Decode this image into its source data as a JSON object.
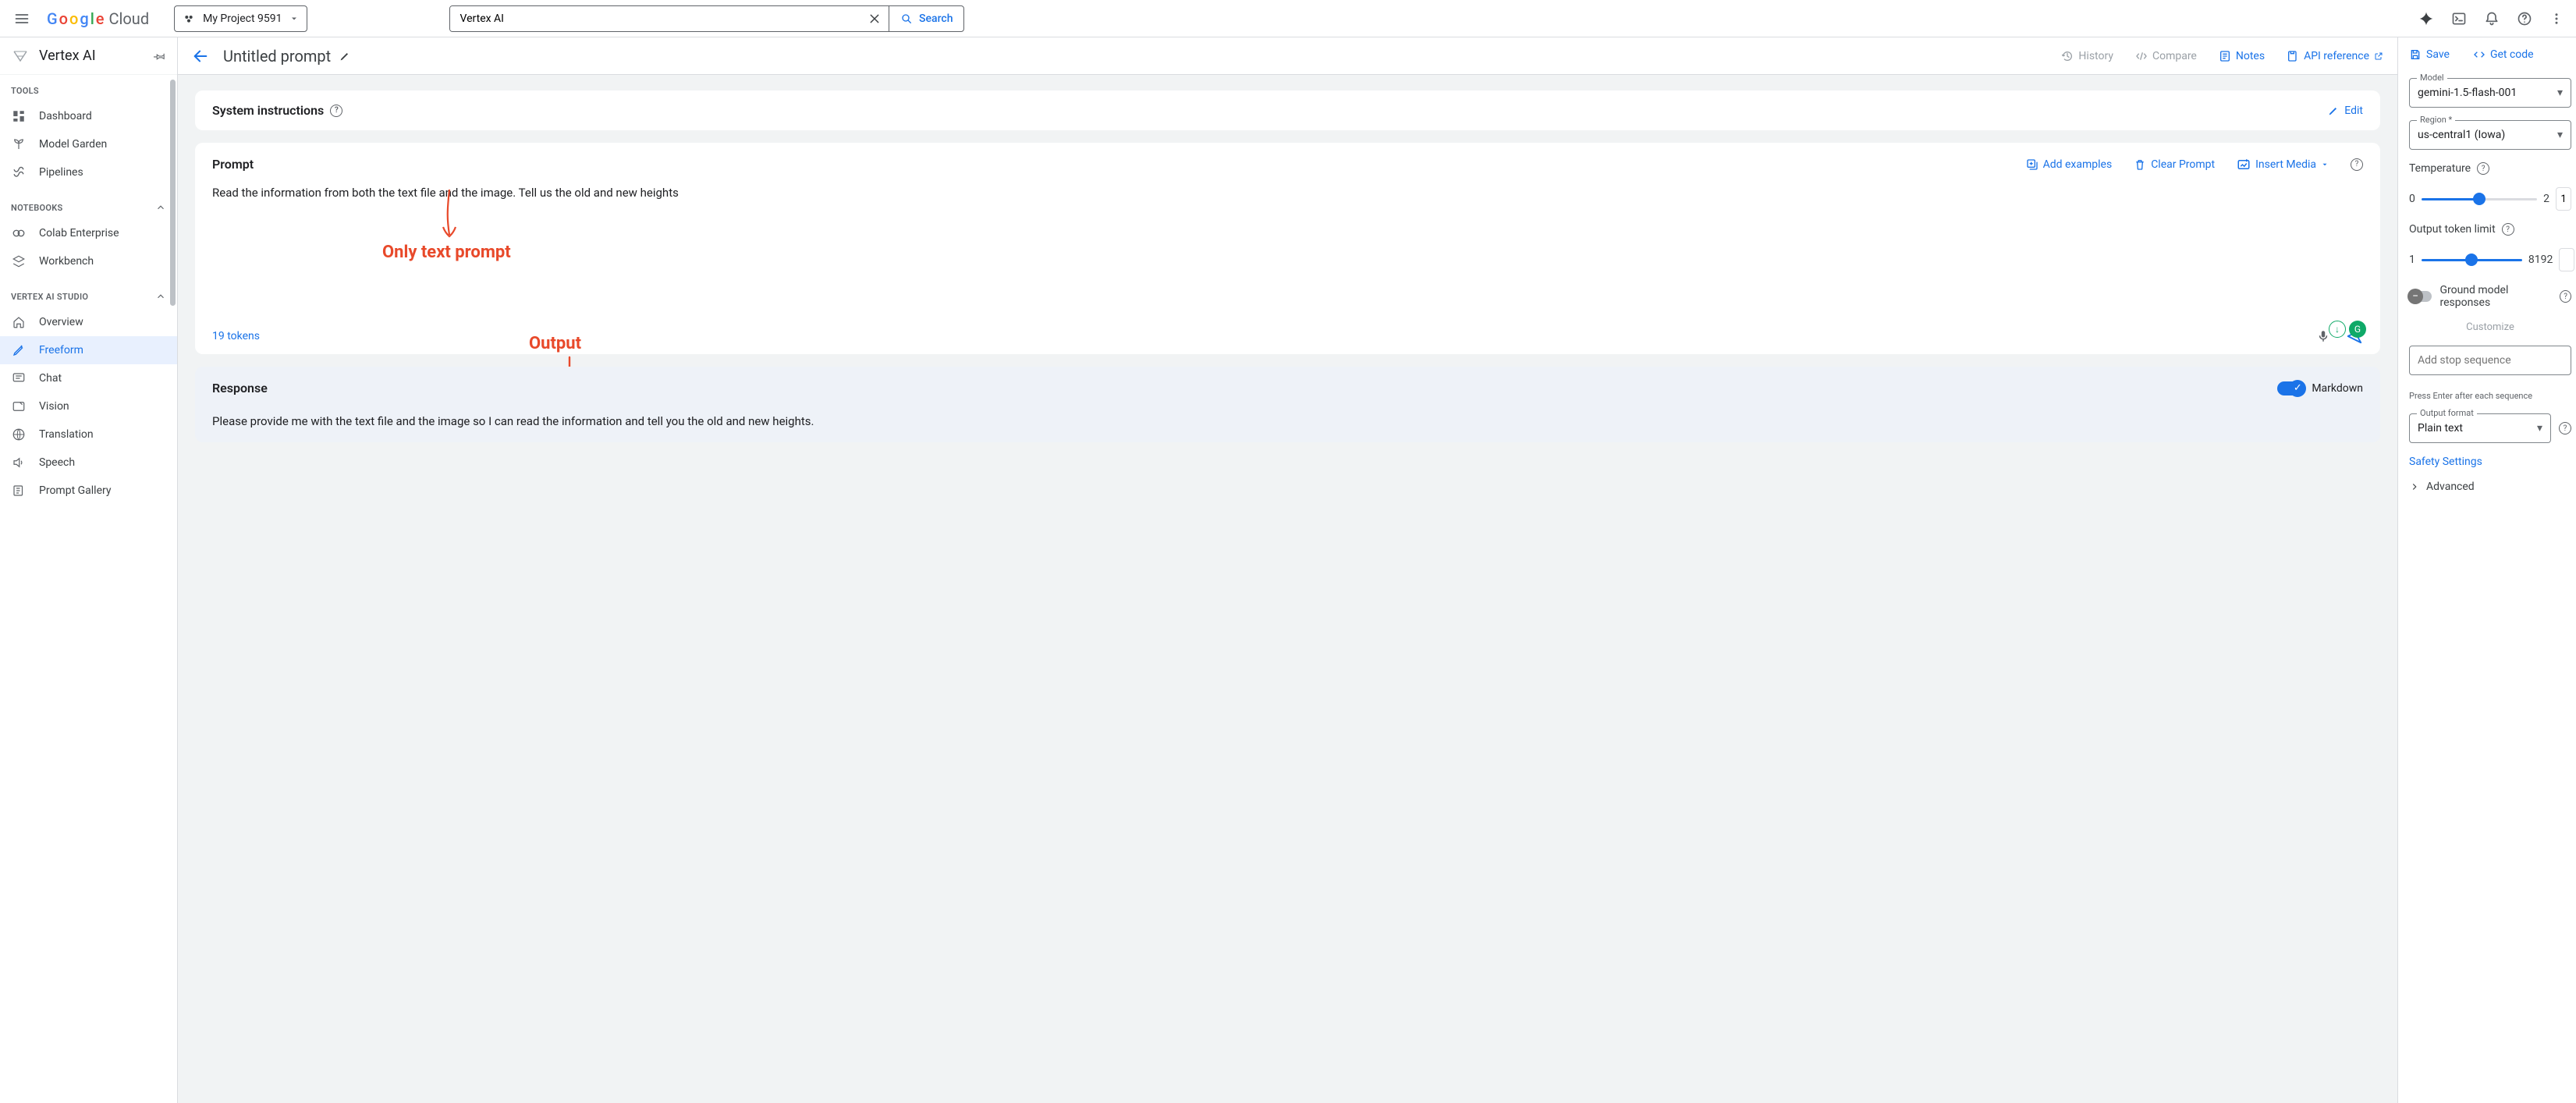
{
  "header": {
    "logo_parts": [
      "G",
      "o",
      "o",
      "g",
      "l",
      "e"
    ],
    "logo_suffix": "Cloud",
    "project_name": "My Project 9591",
    "search_value": "Vertex AI",
    "search_button": "Search"
  },
  "sidebar": {
    "product_title": "Vertex AI",
    "sections": [
      {
        "heading": "TOOLS",
        "collapsible": false,
        "items": [
          {
            "label": "Dashboard",
            "icon": "dashboard-icon"
          },
          {
            "label": "Model Garden",
            "icon": "sprout-icon"
          },
          {
            "label": "Pipelines",
            "icon": "pipelines-icon"
          }
        ]
      },
      {
        "heading": "NOTEBOOKS",
        "collapsible": true,
        "items": [
          {
            "label": "Colab Enterprise",
            "icon": "colab-icon"
          },
          {
            "label": "Workbench",
            "icon": "workbench-icon"
          }
        ]
      },
      {
        "heading": "VERTEX AI STUDIO",
        "collapsible": true,
        "items": [
          {
            "label": "Overview",
            "icon": "home-icon"
          },
          {
            "label": "Freeform",
            "icon": "pencil2-icon",
            "active": true
          },
          {
            "label": "Chat",
            "icon": "chat-icon"
          },
          {
            "label": "Vision",
            "icon": "vision-icon"
          },
          {
            "label": "Translation",
            "icon": "translate-icon"
          },
          {
            "label": "Speech",
            "icon": "speech-icon"
          },
          {
            "label": "Prompt Gallery",
            "icon": "gallery-icon"
          }
        ]
      }
    ]
  },
  "center": {
    "title": "Untitled prompt",
    "actions": {
      "history": "History",
      "compare": "Compare",
      "notes": "Notes",
      "api_reference": "API reference"
    },
    "system_instructions": {
      "title": "System instructions",
      "edit": "Edit"
    },
    "prompt": {
      "title": "Prompt",
      "add_examples": "Add examples",
      "clear_prompt": "Clear Prompt",
      "insert_media": "Insert Media",
      "text": "Read the information from both the text file and the image. Tell us the old and new heights",
      "token_count": "19 tokens"
    },
    "annotations": {
      "prompt": "Only text prompt",
      "response": "Output"
    },
    "response": {
      "title": "Response",
      "markdown": "Markdown",
      "text": "Please provide me with the text file and the image so I can read the information and tell you the old and new heights."
    }
  },
  "right": {
    "save": "Save",
    "get_code": "Get code",
    "model_label": "Model",
    "model_value": "gemini-1.5-flash-001",
    "region_label": "Region *",
    "region_value": "us-central1 (Iowa)",
    "temperature_label": "Temperature",
    "temperature_min": "0",
    "temperature_max": "2",
    "temperature_value": "1",
    "output_limit_label": "Output token limit",
    "output_limit_min": "1",
    "output_limit_value": "8192",
    "ground_label": "Ground model responses",
    "customize": "Customize",
    "stop_seq_placeholder": "Add stop sequence",
    "stop_seq_hint": "Press Enter after each sequence",
    "output_format_label": "Output format",
    "output_format_value": "Plain text",
    "safety": "Safety Settings",
    "advanced": "Advanced"
  }
}
